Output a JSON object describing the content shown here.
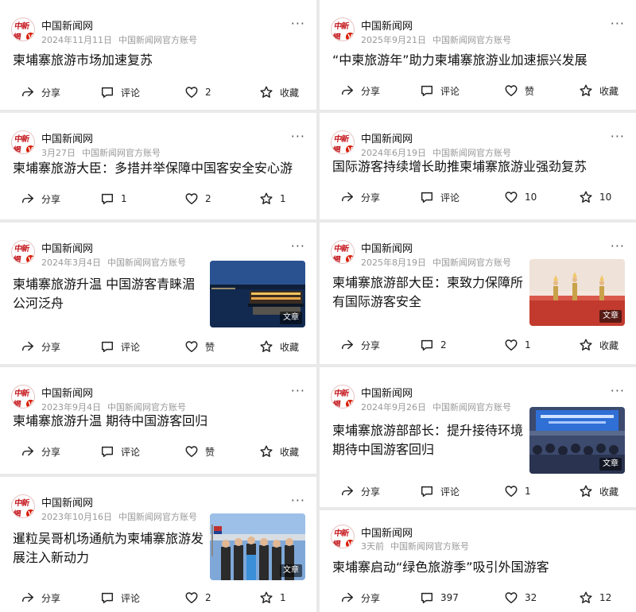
{
  "left_cards": [
    {
      "author": "中国新闻网",
      "date": "2024年11月11日",
      "account": "中国新闻网官方账号",
      "title": "柬埔寨旅游市场加速复苏",
      "share": "分享",
      "comment": "评论",
      "like": "2",
      "fav": "收藏"
    },
    {
      "author": "中国新闻网",
      "date": "3月27日",
      "account": "中国新闻网官方账号",
      "title": "柬埔寨旅游大臣：多措并举保障中国客安全安心游",
      "share": "分享",
      "comment": "1",
      "like": "2",
      "fav": "1"
    },
    {
      "author": "中国新闻网",
      "date": "2024年3月4日",
      "account": "中国新闻网官方账号",
      "title": "柬埔寨旅游升温 中国游客青睐湄公河泛舟",
      "thumb_tag": "文章",
      "share": "分享",
      "comment": "评论",
      "like": "赞",
      "fav": "收藏"
    },
    {
      "author": "中国新闻网",
      "date": "2023年9月4日",
      "account": "中国新闻网官方账号",
      "title": "柬埔寨旅游升温 期待中国游客回归",
      "share": "分享",
      "comment": "评论",
      "like": "赞",
      "fav": "收藏"
    },
    {
      "author": "中国新闻网",
      "date": "2023年10月16日",
      "account": "中国新闻网官方账号",
      "title": "暹粒吴哥机场通航为柬埔寨旅游发展注入新动力",
      "thumb_tag": "文章",
      "share": "分享",
      "comment": "评论",
      "like": "2",
      "fav": "1"
    }
  ],
  "right_cards": [
    {
      "author": "中国新闻网",
      "date": "2025年9月21日",
      "account": "中国新闻网官方账号",
      "title": "“中柬旅游年”助力柬埔寨旅游业加速振兴发展",
      "share": "分享",
      "comment": "评论",
      "like": "赞",
      "fav": "收藏"
    },
    {
      "author": "中国新闻网",
      "date": "2024年6月19日",
      "account": "中国新闻网官方账号",
      "title": "国际游客持续增长助推柬埔寨旅游业强劲复苏",
      "share": "分享",
      "comment": "评论",
      "like": "10",
      "fav": "10"
    },
    {
      "author": "中国新闻网",
      "date": "2025年8月19日",
      "account": "中国新闻网官方账号",
      "title": "柬埔寨旅游部大臣：柬致力保障所有国际游客安全",
      "thumb_tag": "文章",
      "share": "分享",
      "comment": "2",
      "like": "1",
      "fav": "收藏"
    },
    {
      "author": "中国新闻网",
      "date": "2024年9月26日",
      "account": "中国新闻网官方账号",
      "title": "柬埔寨旅游部部长：提升接待环境期待中国游客回归",
      "thumb_tag": "文章",
      "share": "分享",
      "comment": "评论",
      "like": "1",
      "fav": "收藏"
    },
    {
      "author": "中国新闻网",
      "date": "3天前",
      "account": "中国新闻网官方账号",
      "title": "柬埔寨启动“绿色旅游季”吸引外国游客",
      "share": "分享",
      "comment": "397",
      "like": "32",
      "fav": "12"
    }
  ],
  "avatar_seal": "中新網",
  "verified_badge": "V",
  "icons": {
    "more": "more-dots-icon",
    "share": "share-arrow-icon",
    "comment": "comment-bubble-icon",
    "like": "heart-icon",
    "fav": "star-icon"
  },
  "colors": {
    "brand_red": "#c4161c",
    "meta_gray": "#999999",
    "background": "#e9e9e9"
  }
}
